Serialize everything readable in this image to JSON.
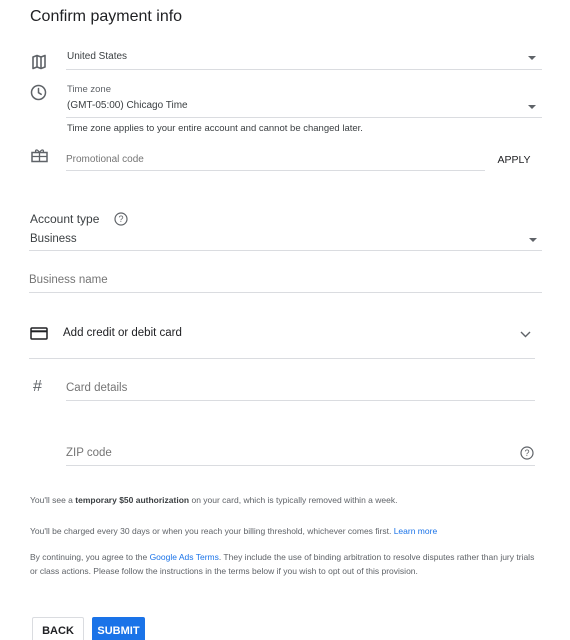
{
  "page": {
    "title": "Confirm payment info"
  },
  "country": {
    "value": "United States",
    "icon": "map-icon"
  },
  "timezone": {
    "label": "Time zone",
    "value": "(GMT-05:00) Chicago Time",
    "helper": "Time zone applies to your entire account and cannot be changed later.",
    "icon": "clock-icon"
  },
  "promo": {
    "placeholder": "Promotional code",
    "apply_label": "APPLY",
    "icon": "gift-icon"
  },
  "account_type": {
    "label": "Account type",
    "value": "Business"
  },
  "business_name": {
    "placeholder": "Business name"
  },
  "card": {
    "section_label": "Add credit or debit card",
    "details_placeholder": "Card details",
    "zip_placeholder": "ZIP code",
    "hash_symbol": "#"
  },
  "notices": {
    "auth_prefix": "You'll see a ",
    "auth_bold": "temporary $50 authorization",
    "auth_suffix": " on your card, which is typically removed within a week.",
    "billing_prefix": "You'll be charged every 30 days or when you reach your billing threshold, whichever comes first. ",
    "billing_link": "Learn more",
    "terms_prefix": "By continuing, you agree to the ",
    "terms_link": "Google Ads Terms",
    "terms_suffix": ". They include the use of binding arbitration to resolve disputes rather than jury trials or class actions. Please follow the instructions in the terms below if you wish to opt out of this provision."
  },
  "buttons": {
    "back": "BACK",
    "submit": "SUBMIT"
  },
  "colors": {
    "accent": "#1a73e8",
    "divider": "#dadce0"
  }
}
